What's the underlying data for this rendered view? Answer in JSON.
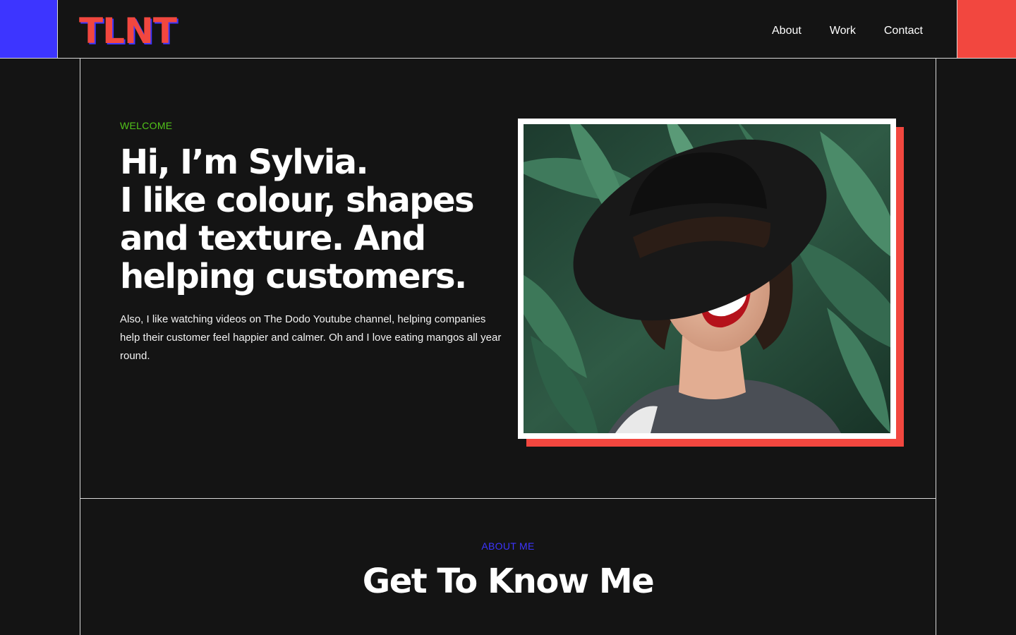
{
  "colors": {
    "background": "#141414",
    "blue_accent": "#3d35ff",
    "red_accent": "#f2473f",
    "green_accent": "#52c41a",
    "about_blue": "#3d35ff",
    "text": "#ffffff"
  },
  "header": {
    "logo": "TLNT",
    "nav": [
      "About",
      "Work",
      "Contact"
    ]
  },
  "hero": {
    "eyebrow": "WELCOME",
    "title_lines": [
      "Hi, I’m Sylvia.",
      "I like colour, shapes",
      "and texture. And",
      "helping customers."
    ],
    "description": "Also, I like watching videos on The Dodo Youtube channel, helping companies help their customer feel happier and calmer. Oh and I love eating mangos all year round."
  },
  "about": {
    "eyebrow": "ABOUT ME",
    "title": "Get To Know Me"
  }
}
